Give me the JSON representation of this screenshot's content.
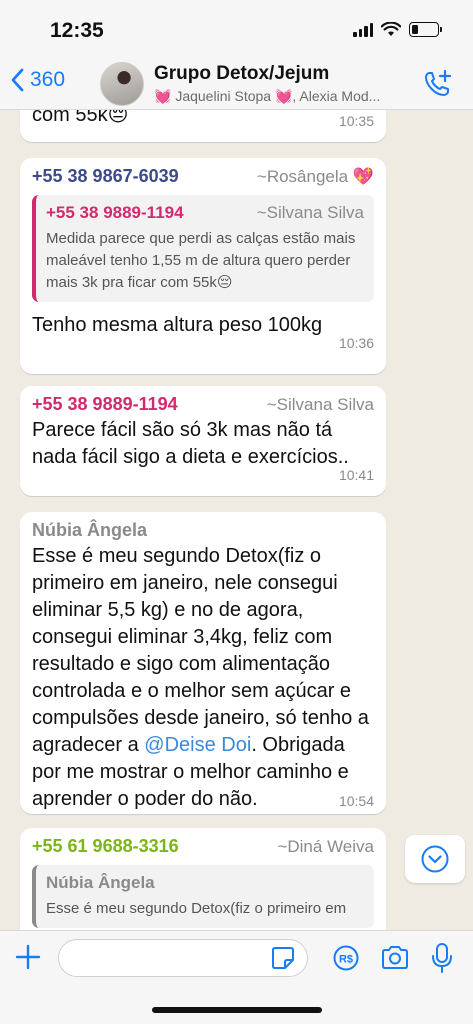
{
  "status_bar": {
    "time": "12:35"
  },
  "header": {
    "back_count": "360",
    "group_title": "Grupo Detox/Jejum",
    "members_prefix_emoji": "💓",
    "members": "Jaquelini Stopa 💓, Alexia Mod..."
  },
  "messages": [
    {
      "text": "com 55k😔",
      "time": "10:35"
    },
    {
      "sender_phone": "+55 38 9867-6039",
      "sender_name": "~Rosângela 💖",
      "sender_color": "#3b4a8a",
      "quote": {
        "phone": "+55 38 9889-1194",
        "name": "~Silvana Silva",
        "color": "#d12a6f",
        "text": "Medida parece que perdi as calças estão mais maleável tenho 1,55 m de altura quero perder mais 3k pra ficar com 55k😔"
      },
      "text": "Tenho mesma altura peso 100kg",
      "time": "10:36"
    },
    {
      "sender_phone": "+55 38 9889-1194",
      "sender_name": "~Silvana Silva",
      "sender_color": "#d12a6f",
      "text": "Parece fácil são só 3k mas não tá nada fácil sigo a dieta e exercícios..",
      "time": "10:41"
    },
    {
      "sender_phone": "Núbia Ângela",
      "sender_color": "#8a8a8a",
      "text_before": "Esse é meu segundo Detox(fiz o primeiro em janeiro, nele consegui eliminar 5,5 kg) e no de agora, consegui eliminar 3,4kg, feliz com resultado e sigo com alimentação controlada e o melhor sem açúcar e compulsões desde janeiro, só tenho a agradecer a ",
      "mention": "@Deise Doi",
      "text_after": ". Obrigada por me mostrar o melhor caminho e aprender o poder do não.",
      "time": "10:54"
    },
    {
      "sender_phone": "+55 61 9688-3316",
      "sender_name": "~Diná Weiva",
      "sender_color": "#7cb518",
      "quote": {
        "phone": "Núbia Ângela",
        "color": "#8a8a8a",
        "text": "Esse é meu segundo Detox(fiz o primeiro em"
      }
    }
  ]
}
